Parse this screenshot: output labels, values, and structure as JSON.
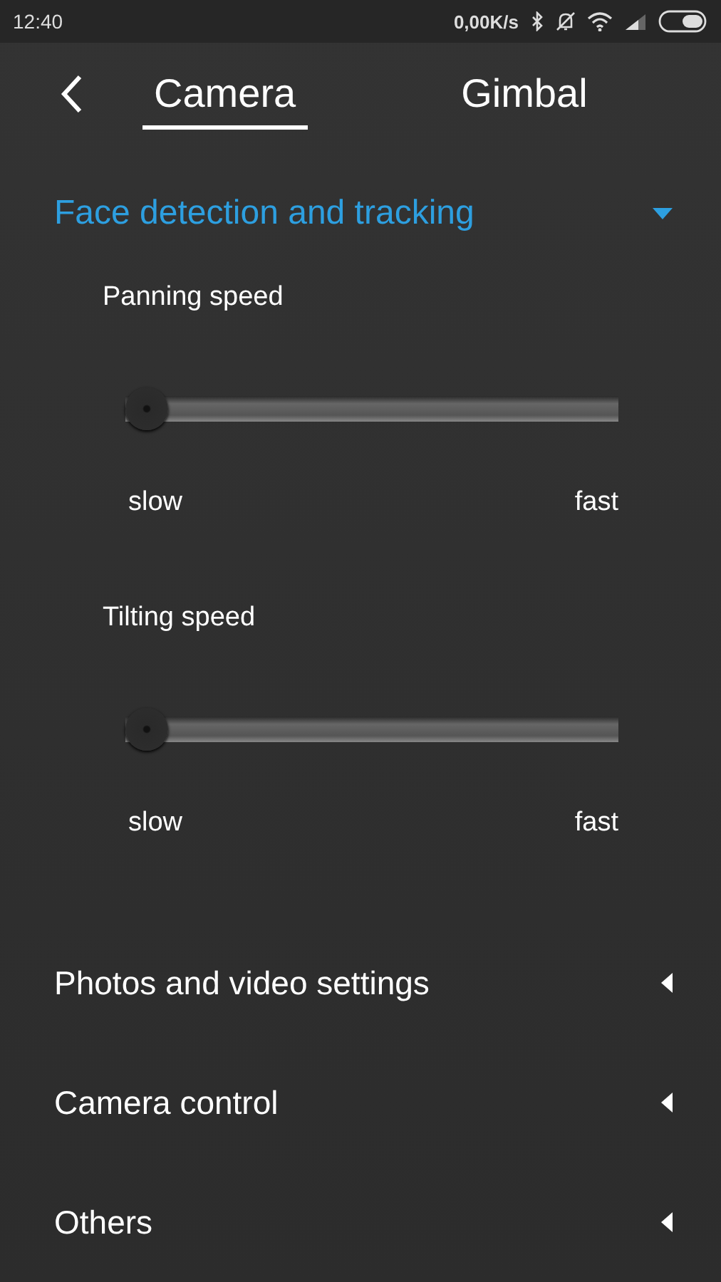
{
  "status_bar": {
    "time": "12:40",
    "speed": "0,00K/s"
  },
  "header": {
    "tabs": [
      {
        "label": "Camera",
        "selected": true
      },
      {
        "label": "Gimbal",
        "selected": false
      }
    ]
  },
  "sections": [
    {
      "title": "Face detection and tracking",
      "expanded": true,
      "sliders": [
        {
          "label": "Panning speed",
          "level": 0,
          "min_label": "slow",
          "max_label": "fast"
        },
        {
          "label": "Tilting speed",
          "level": 0,
          "min_label": "slow",
          "max_label": "fast"
        }
      ]
    },
    {
      "title": "Photos and video settings",
      "expanded": false
    },
    {
      "title": "Camera control",
      "expanded": false
    },
    {
      "title": "Others",
      "expanded": false
    }
  ]
}
